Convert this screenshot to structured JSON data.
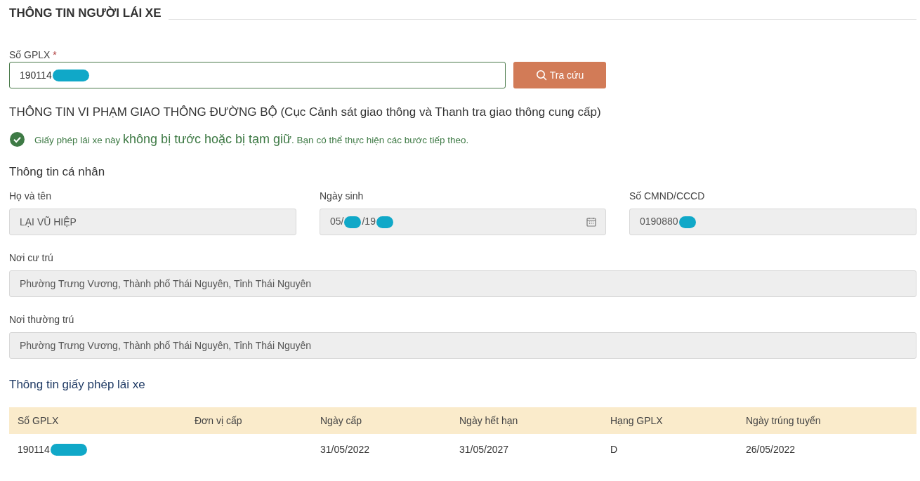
{
  "header": {
    "title": "THÔNG TIN NGƯỜI LÁI XE"
  },
  "search": {
    "label": "Số GPLX",
    "required_mark": "*",
    "value": [
      {
        "text": "190114",
        "redacted": true
      }
    ],
    "button": "Tra cứu"
  },
  "violation": {
    "title": "THÔNG TIN VI PHẠM GIAO THÔNG ĐƯỜNG BỘ (Cục Cảnh sát giao thông và Thanh tra giao thông cung cấp)",
    "ok": true,
    "message": "Giấy phép lái xe này **không bị tước hoặc bị tạm giữ**. Bạn có thể thực hiện các bước tiếp theo."
  },
  "personal": {
    "title": "Thông tin cá nhân",
    "fields": [
      {
        "label": "Họ và tên",
        "kind": "text",
        "value": [
          {
            "text": "LẠI VŨ HIỆP",
            "redacted": false
          }
        ]
      },
      {
        "label": "Ngày sinh",
        "kind": "date",
        "value": [
          {
            "text": "05/",
            "redacted": true
          },
          {
            "text": "/19",
            "redacted": true
          }
        ]
      },
      {
        "label": "Số CMND/CCCD",
        "kind": "text",
        "value": [
          {
            "text": "0190880",
            "redacted": true
          }
        ]
      }
    ],
    "address_fields": [
      {
        "label": "Nơi cư trú",
        "value": "Phường Trưng Vương, Thành phố Thái Nguyên, Tỉnh Thái Nguyên"
      },
      {
        "label": "Nơi thường trú",
        "value": "Phường Trưng Vương, Thành phố Thái Nguyên, Tỉnh Thái Nguyên"
      }
    ]
  },
  "license": {
    "title": "Thông tin giấy phép lái xe",
    "table": {
      "columns": [
        "Số GPLX",
        "Đơn vị cấp",
        "Ngày cấp",
        "Ngày hết hạn",
        "Hạng GPLX",
        "Ngày trúng tuyển"
      ],
      "rows": [
        [
          {
            "text": "190114",
            "redacted": true
          },
          {
            "text": ""
          },
          {
            "text": "31/05/2022",
            "redacted": false
          },
          {
            "text": "31/05/2027",
            "redacted": false
          },
          {
            "text": "D",
            "redacted": false
          },
          {
            "text": "26/05/2022",
            "redacted": false
          }
        ]
      ]
    }
  }
}
